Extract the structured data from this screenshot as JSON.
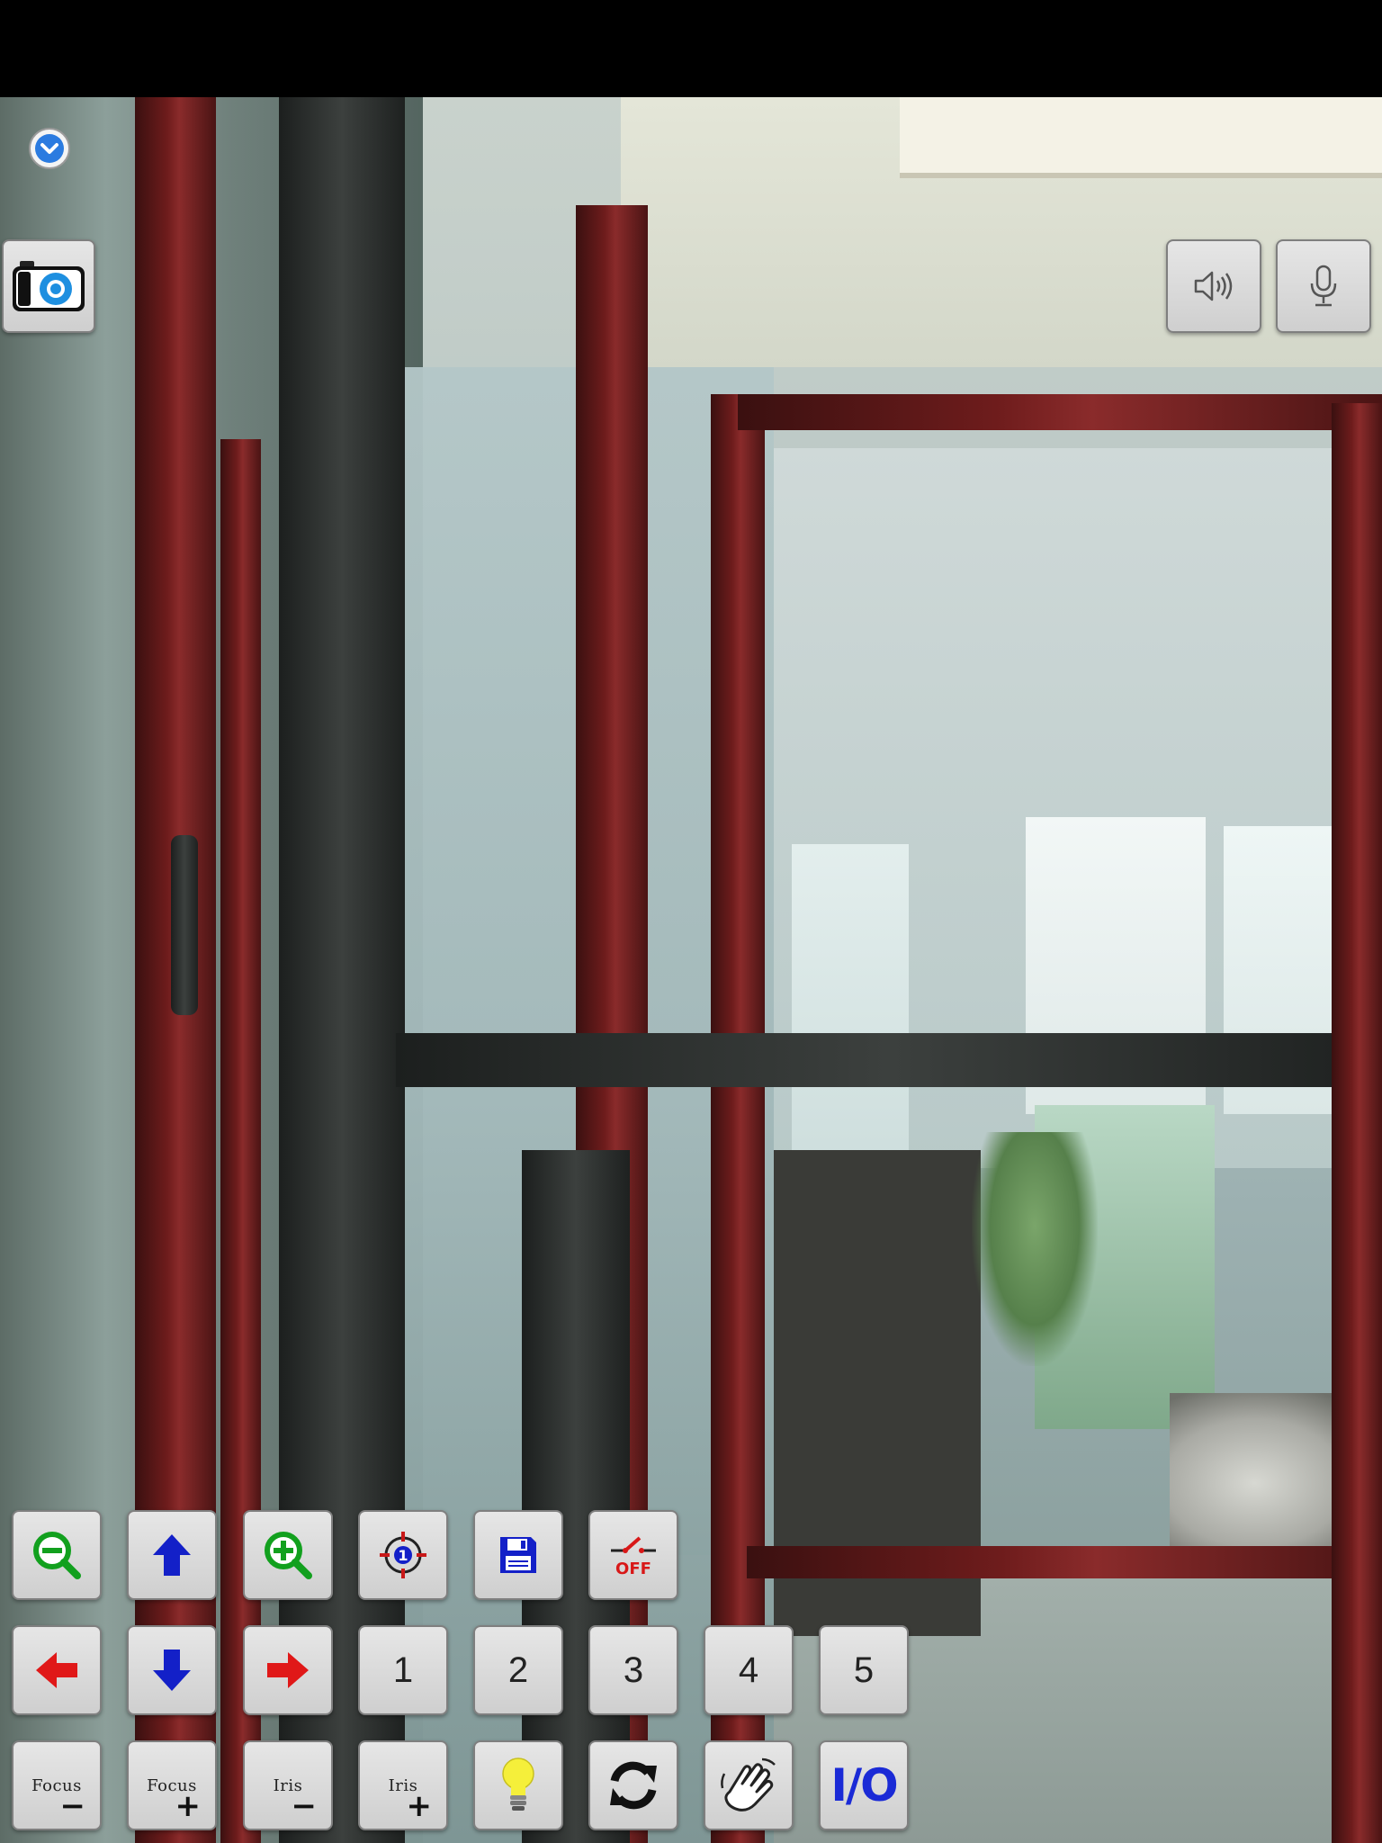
{
  "toolbar": {
    "expand_icon": "chevron-down-icon",
    "snapshot_icon": "camera-icon",
    "speaker_icon": "speaker-icon",
    "mic_icon": "microphone-icon"
  },
  "ptz": {
    "row1": [
      {
        "name": "zoom-out-button",
        "icon": "zoom-out-icon"
      },
      {
        "name": "tilt-up-button",
        "icon": "arrow-up-icon"
      },
      {
        "name": "zoom-in-button",
        "icon": "zoom-in-icon"
      },
      {
        "name": "preset-target-button",
        "icon": "target-icon"
      },
      {
        "name": "save-preset-button",
        "icon": "floppy-disk-icon"
      },
      {
        "name": "switch-off-button",
        "icon": "switch-off-icon"
      }
    ],
    "presets": [
      "1",
      "2",
      "3",
      "4",
      "5"
    ],
    "focus_minus": {
      "label": "Focus",
      "sign": "−"
    },
    "focus_plus": {
      "label": "Focus",
      "sign": "+"
    },
    "iris_minus": {
      "label": "Iris",
      "sign": "−"
    },
    "iris_plus": {
      "label": "Iris",
      "sign": "+"
    },
    "light_icon": "light-bulb-icon",
    "cruise_icon": "refresh-icon",
    "hand_icon": "hand-wave-icon",
    "io_label": "I/O"
  },
  "colors": {
    "zoom_green": "#12a01e",
    "arrow_blue": "#1320c8",
    "arrow_red": "#e01818",
    "button_bg": "#d9d9d9"
  }
}
